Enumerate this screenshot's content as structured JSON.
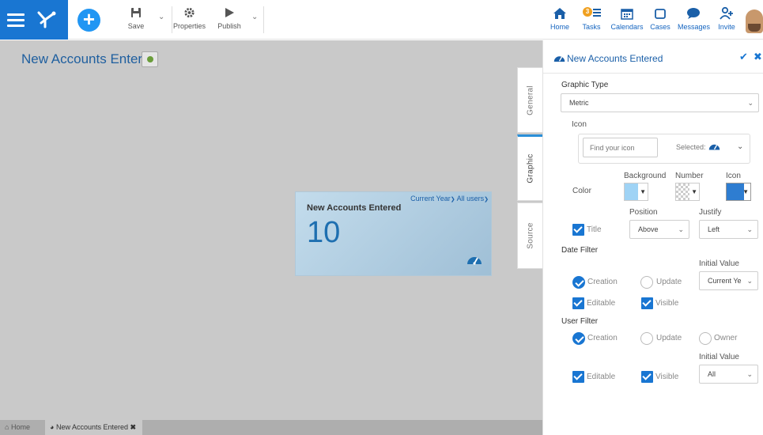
{
  "toolbar": {
    "save_label": "Save",
    "properties_label": "Properties",
    "publish_label": "Publish"
  },
  "nav": {
    "home": "Home",
    "tasks": "Tasks",
    "tasks_badge": "3",
    "calendars": "Calendars",
    "cases": "Cases",
    "messages": "Messages",
    "invite": "Invite"
  },
  "canvas": {
    "title": "New Accounts Entered"
  },
  "widget": {
    "title": "New Accounts Entered",
    "filter_date": "Current Year",
    "filter_user": "All users",
    "value": "10"
  },
  "tabs": {
    "general": "General",
    "graphic": "Graphic",
    "source": "Source"
  },
  "bottom_tabs": {
    "home": "Home",
    "document": "New Accounts Entered"
  },
  "panel": {
    "title": "New Accounts Entered",
    "graphic_type_label": "Graphic Type",
    "graphic_type_value": "Metric",
    "icon_label": "Icon",
    "icon_search_placeholder": "Find your icon",
    "icon_selected_label": "Selected:",
    "color_label": "Color",
    "background_label": "Background",
    "number_label": "Number",
    "icon_col_label": "Icon",
    "position_label": "Position",
    "justify_label": "Justify",
    "title_check_label": "Title",
    "position_value": "Above",
    "justify_value": "Left",
    "date_filter_label": "Date Filter",
    "initial_value_label": "Initial Value",
    "creation_label": "Creation",
    "update_label": "Update",
    "date_initial_value": "Current Ye",
    "editable_label": "Editable",
    "visible_label": "Visible",
    "user_filter_label": "User Filter",
    "user_creation_label": "Creation",
    "user_update_label": "Update",
    "owner_label": "Owner",
    "user_initial_value_label": "Initial Value",
    "user_initial_value": "All",
    "user_editable_label": "Editable",
    "user_visible_label": "Visible"
  },
  "colors": {
    "brand": "#1976d2",
    "background_swatch": "#9fd3f5",
    "icon_swatch": "#2e7dd1"
  }
}
